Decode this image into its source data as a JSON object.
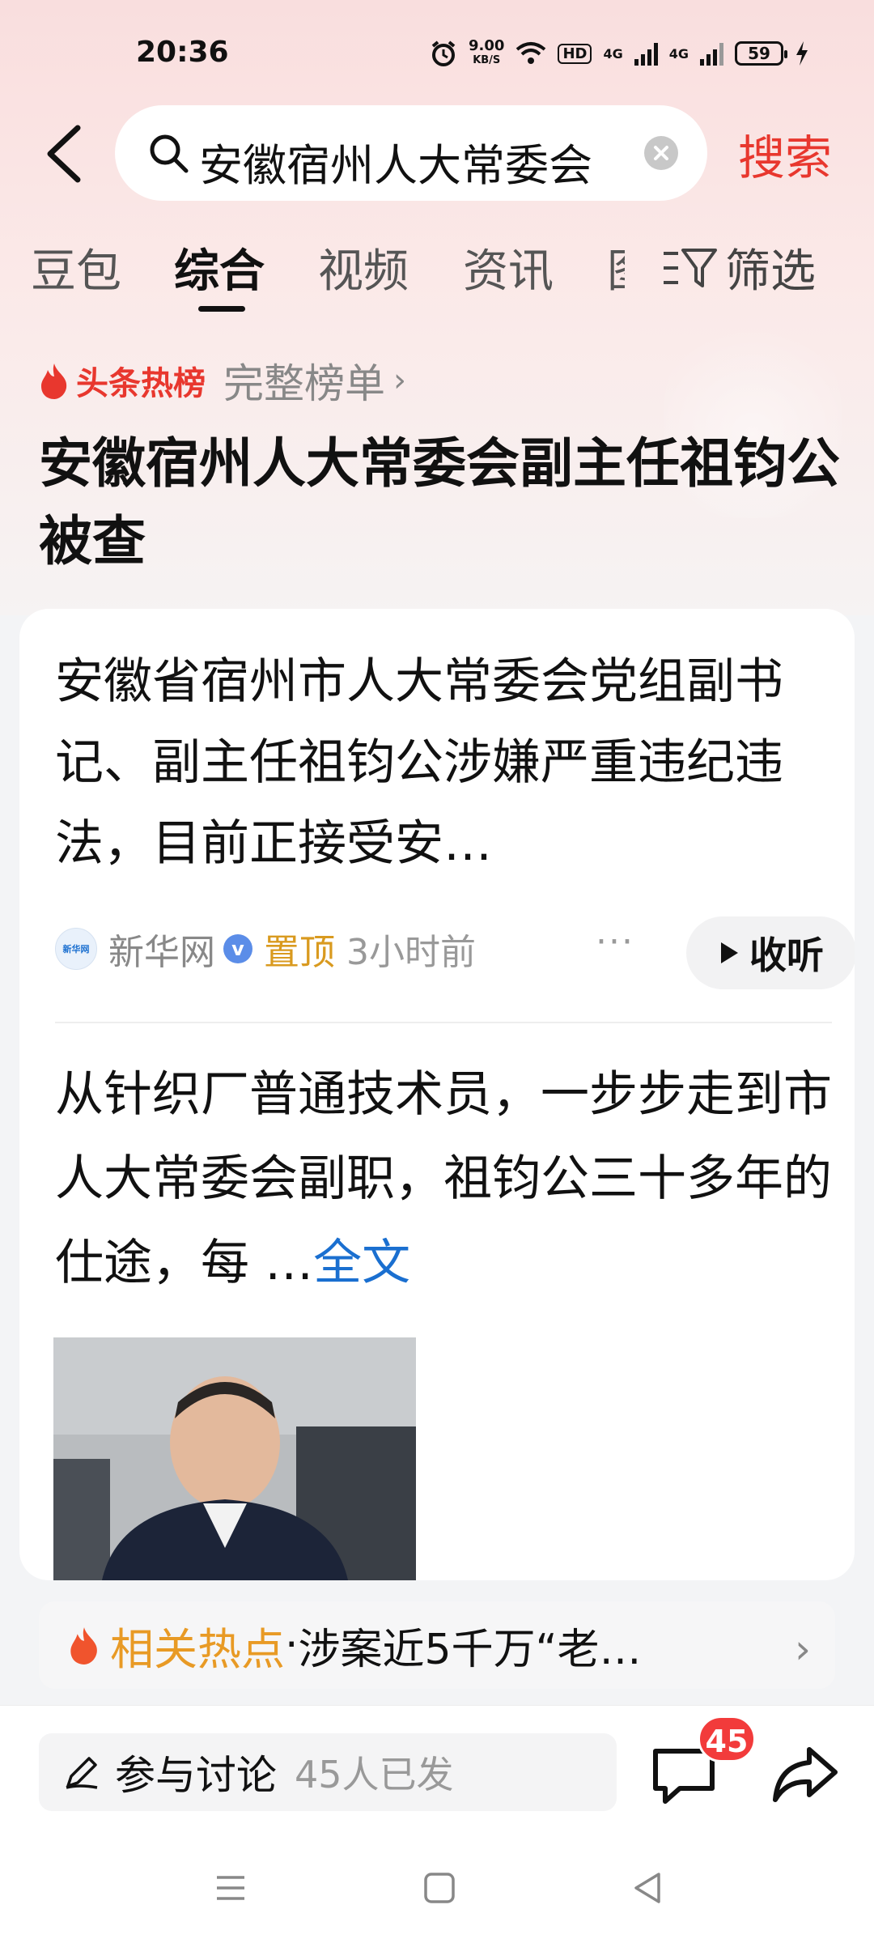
{
  "status_bar": {
    "time": "20:36",
    "net_speed": "9.00",
    "net_unit": "KB/S",
    "hd_label": "HD",
    "net_gen_1": "4G",
    "net_gen_2": "4G",
    "battery": "59"
  },
  "header": {
    "search_query": "安徽宿州人大常委会",
    "search_button": "搜索"
  },
  "tabs": [
    {
      "label": "豆包"
    },
    {
      "label": "综合",
      "active": true
    },
    {
      "label": "视频"
    },
    {
      "label": "资讯"
    },
    {
      "label": "图"
    }
  ],
  "filter_label": "筛选",
  "hot_list": {
    "label": "头条热榜",
    "full_list": "完整榜单",
    "title": "安徽宿州人大常委会副主任祖钧公被查"
  },
  "articles": [
    {
      "text": "安徽省宿州市人大常委会党组副书记、副主任祖钧公涉嫌严重违纪违法，目前正接受安…",
      "source": "新华网",
      "source_logo_text": "新华网",
      "pinned": "置顶",
      "time": "3小时前",
      "listen": "收听"
    },
    {
      "text": "从针织厂普通技术员，一步步走到市人大常委会副职，祖钧公三十多年的仕途，每 …",
      "full_text_link": "全文"
    }
  ],
  "related": {
    "label": "相关热点",
    "separator": "·",
    "text": "涉案近5千万“老…"
  },
  "bottom": {
    "discuss_label": "参与讨论",
    "discuss_count": "45人已发",
    "comment_badge": "45"
  },
  "colors": {
    "accent_red": "#e8372e",
    "link_blue": "#1a6fd0",
    "pinned_gold": "#d99a1f",
    "related_orange": "#e89a25"
  }
}
